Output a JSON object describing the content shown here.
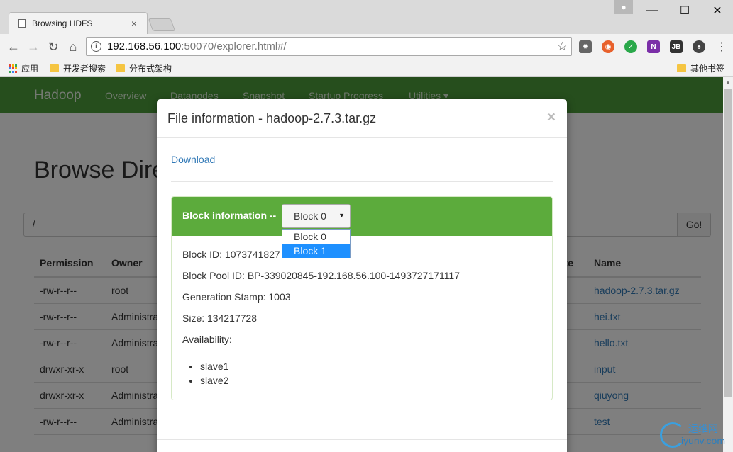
{
  "browser": {
    "tab_title": "Browsing HDFS",
    "tab_close": "×",
    "url_host": "192.168.56.100",
    "url_rest": ":50070/explorer.html#/",
    "minimize": "—",
    "maximize": "☐",
    "close": "✕",
    "bookmarks": {
      "apps": "应用",
      "items": [
        "开发者搜索",
        "分布式架构"
      ],
      "other": "其他书签"
    }
  },
  "navbar": {
    "brand": "Hadoop",
    "links": [
      "Overview",
      "Datanodes",
      "Snapshot",
      "Startup Progress",
      "Utilities ▾"
    ]
  },
  "page": {
    "title": "Browse Directory",
    "path_value": "/",
    "go_label": "Go!",
    "columns": [
      "Permission",
      "Owner",
      "Size",
      "Name"
    ],
    "rows": [
      {
        "permission": "-rw-r--r--",
        "owner": "root",
        "name": "hadoop-2.7.3.tar.gz"
      },
      {
        "permission": "-rw-r--r--",
        "owner": "Administrator",
        "name": "hei.txt"
      },
      {
        "permission": "-rw-r--r--",
        "owner": "Administrator",
        "name": "hello.txt"
      },
      {
        "permission": "drwxr-xr-x",
        "owner": "root",
        "name": "input"
      },
      {
        "permission": "drwxr-xr-x",
        "owner": "Administrator",
        "name": "qiuyong"
      },
      {
        "permission": "-rw-r--r--",
        "owner": "Administrator",
        "name": "test"
      }
    ]
  },
  "modal": {
    "title": "File information - hadoop-2.7.3.tar.gz",
    "close": "×",
    "download": "Download",
    "block_heading": "Block information --",
    "selected_block": "Block 0",
    "block_options": [
      "Block 0",
      "Block 1"
    ],
    "highlighted_option": "Block 1",
    "block_id": "Block ID: 1073741827",
    "block_pool_id": "Block Pool ID: BP-339020845-192.168.56.100-1493727171117",
    "generation_stamp": "Generation Stamp: 1003",
    "size": "Size: 134217728",
    "availability_label": "Availability:",
    "availability": [
      "slave1",
      "slave2"
    ]
  },
  "watermark": {
    "top": "运维网",
    "bottom": "iyunv.com"
  }
}
